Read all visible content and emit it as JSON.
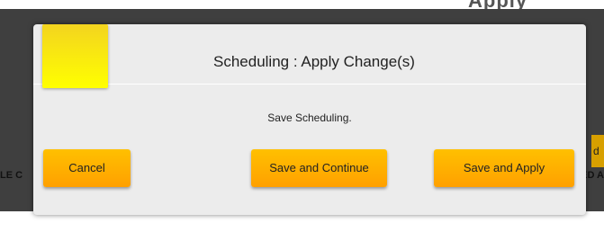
{
  "background": {
    "top_text": "Apply",
    "left_label": "LE C",
    "right_label": "ED A",
    "side_button_text": "d"
  },
  "dialog": {
    "title": "Scheduling : Apply Change(s)",
    "message": "Save Scheduling.",
    "buttons": {
      "cancel": "Cancel",
      "save_continue": "Save and Continue",
      "save_apply": "Save and Apply"
    }
  },
  "colors": {
    "button_top": "#ffc000",
    "button_bottom": "#ffa000",
    "logo_top": "#f3d41f",
    "logo_bottom": "#ffff00",
    "dialog_bg": "#ececec",
    "overlay": "#3f3f3f"
  }
}
